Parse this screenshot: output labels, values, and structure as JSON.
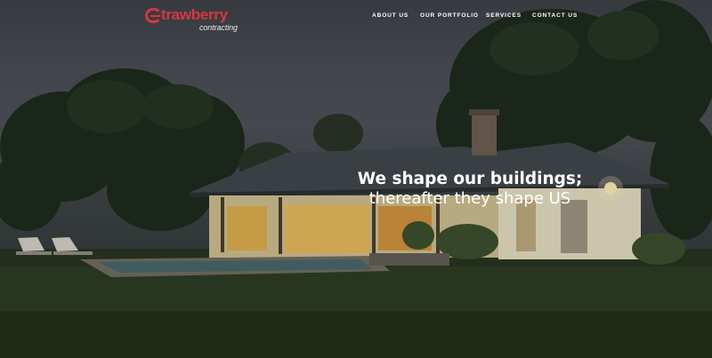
{
  "brand": {
    "name": "trawberry",
    "tagline": "contracting",
    "accent_color": "#d6373f"
  },
  "nav": {
    "items": [
      {
        "label": "ABOUT US"
      },
      {
        "label": "OUR PORTFOLIO"
      },
      {
        "label": "SERVICES"
      },
      {
        "label": "CONTACT US"
      }
    ]
  },
  "hero": {
    "headline": "We shape our buildings;",
    "subheadline": "thereafter they shape US"
  }
}
